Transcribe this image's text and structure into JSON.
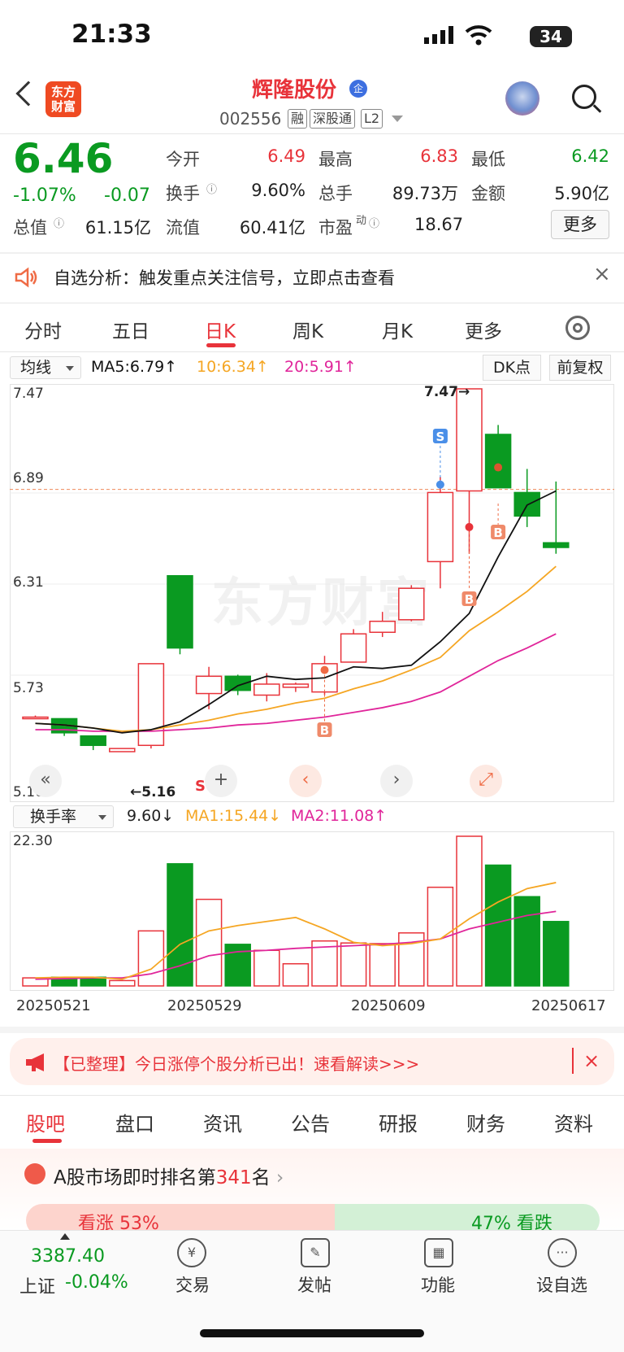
{
  "status_bar": {
    "time": "21:33",
    "battery": "34"
  },
  "header": {
    "logo_text": "东方财富",
    "stock_name": "辉隆股份",
    "badge": "企",
    "code": "002556",
    "tags": [
      "融",
      "深股通",
      "L2"
    ]
  },
  "quote": {
    "price": "6.46",
    "change_pct": "-1.07%",
    "change": "-0.07",
    "open_label": "今开",
    "open": "6.49",
    "high_label": "最高",
    "high": "6.83",
    "low_label": "最低",
    "low": "6.42",
    "turnover_label": "换手",
    "turnover": "9.60%",
    "volume_label": "总手",
    "volume": "89.73万",
    "amount_label": "金额",
    "amount": "5.90亿",
    "mktcap_label": "总值",
    "mktcap": "61.15亿",
    "float_label": "流值",
    "float": "60.41亿",
    "pe_label": "市盈",
    "pe_sup": "动",
    "pe": "18.67",
    "more_label": "更多"
  },
  "alert": {
    "text": "自选分析：触发重点关注信号，立即点击查看",
    "close": "×"
  },
  "tabs": [
    "分时",
    "五日",
    "日K",
    "周K",
    "月K",
    "更多"
  ],
  "ma_row": {
    "select": "均线",
    "ma5": "MA5:6.79↑",
    "ma10": "10:6.34↑",
    "ma20": "20:5.91↑",
    "dk": "DK点",
    "fq": "前复权"
  },
  "kline": {
    "y_labels": [
      "7.47",
      "6.89",
      "6.31",
      "5.73",
      "5.16"
    ],
    "high_marker": "7.47→",
    "low_marker": "←5.16",
    "watermark": "东方财富",
    "signals": {
      "s_blue": "S",
      "s_red": "S",
      "b1": "B",
      "b2": "B",
      "b3": "B"
    }
  },
  "turnover_row": {
    "select": "换手率",
    "value": "9.60↓",
    "ma1": "MA1:15.44↓",
    "ma2": "MA2:11.08↑",
    "y_max": "22.30"
  },
  "dates": [
    "20250521",
    "20250529",
    "20250609",
    "20250617"
  ],
  "ad": {
    "text": "【已整理】今日涨停个股分析已出！速看解读>>>",
    "close": "×"
  },
  "bottom_tabs": [
    "股吧",
    "盘口",
    "资讯",
    "公告",
    "研报",
    "财务",
    "资料"
  ],
  "rank": {
    "prefix": "A股市场即时排名第",
    "num": "341",
    "suffix": "名",
    "bull": "看涨 53%",
    "bear": "47% 看跌"
  },
  "bottom_nav": {
    "index_value": "3387.40",
    "index_label": "上证",
    "index_pct": "-0.04%",
    "items": [
      "交易",
      "发帖",
      "功能",
      "设自选"
    ]
  },
  "colors": {
    "up": "#e8333a",
    "down": "#0a9a21",
    "ma5": "#111111",
    "ma10": "#f5a623",
    "ma20": "#e0259a"
  },
  "chart_data": {
    "type": "candlestick",
    "title": "",
    "ylim": [
      5.16,
      7.47
    ],
    "candles": [
      {
        "o": 5.38,
        "h": 5.39,
        "l": 5.37,
        "c": 5.38
      },
      {
        "o": 5.37,
        "h": 5.37,
        "l": 5.26,
        "c": 5.28
      },
      {
        "o": 5.26,
        "h": 5.26,
        "l": 5.17,
        "c": 5.2
      },
      {
        "o": 5.16,
        "h": 5.18,
        "l": 5.16,
        "c": 5.18
      },
      {
        "o": 5.2,
        "h": 5.72,
        "l": 5.18,
        "c": 5.72
      },
      {
        "o": 6.28,
        "h": 6.28,
        "l": 5.78,
        "c": 5.82
      },
      {
        "o": 5.53,
        "h": 5.7,
        "l": 5.43,
        "c": 5.64
      },
      {
        "o": 5.64,
        "h": 5.65,
        "l": 5.52,
        "c": 5.55
      },
      {
        "o": 5.52,
        "h": 5.66,
        "l": 5.48,
        "c": 5.59
      },
      {
        "o": 5.57,
        "h": 5.6,
        "l": 5.54,
        "c": 5.59
      },
      {
        "o": 5.54,
        "h": 5.77,
        "l": 5.52,
        "c": 5.72
      },
      {
        "o": 5.73,
        "h": 5.94,
        "l": 5.73,
        "c": 5.91
      },
      {
        "o": 5.92,
        "h": 6.05,
        "l": 5.89,
        "c": 5.99
      },
      {
        "o": 6.0,
        "h": 6.22,
        "l": 5.99,
        "c": 6.2
      },
      {
        "o": 6.37,
        "h": 6.91,
        "l": 6.2,
        "c": 6.81
      },
      {
        "o": 6.82,
        "h": 7.47,
        "l": 6.42,
        "c": 7.47
      },
      {
        "o": 7.18,
        "h": 7.24,
        "l": 6.84,
        "c": 6.84
      },
      {
        "o": 6.81,
        "h": 6.96,
        "l": 6.59,
        "c": 6.66
      },
      {
        "o": 6.49,
        "h": 6.88,
        "l": 6.42,
        "c": 6.46
      }
    ],
    "ma5": [
      5.34,
      5.33,
      5.31,
      5.28,
      5.3,
      5.35,
      5.46,
      5.58,
      5.64,
      5.62,
      5.63,
      5.7,
      5.69,
      5.71,
      5.86,
      6.04,
      6.4,
      6.73,
      6.82
    ],
    "ma10": [
      5.34,
      5.33,
      5.31,
      5.29,
      5.3,
      5.33,
      5.36,
      5.4,
      5.43,
      5.47,
      5.5,
      5.56,
      5.61,
      5.68,
      5.76,
      5.93,
      6.05,
      6.18,
      6.34
    ],
    "ma20": [
      5.3,
      5.3,
      5.29,
      5.29,
      5.29,
      5.3,
      5.31,
      5.33,
      5.34,
      5.36,
      5.38,
      5.41,
      5.44,
      5.48,
      5.54,
      5.64,
      5.74,
      5.82,
      5.91
    ],
    "turnover": [
      1.2,
      1.3,
      1.3,
      0.8,
      8.2,
      18.2,
      12.9,
      6.2,
      5.3,
      3.3,
      6.7,
      6.4,
      6.3,
      7.9,
      14.7,
      22.3,
      18.0,
      13.3,
      9.6
    ],
    "turnover_ma1": [
      1.2,
      1.3,
      1.3,
      1.0,
      2.5,
      6.2,
      8.2,
      9.0,
      9.6,
      10.2,
      8.5,
      6.5,
      6.0,
      6.3,
      7.0,
      10.0,
      12.5,
      14.5,
      15.4
    ],
    "turnover_ma2": [
      1.0,
      1.1,
      1.2,
      1.2,
      1.8,
      3.0,
      4.5,
      5.1,
      5.3,
      5.6,
      5.8,
      6.0,
      6.2,
      6.5,
      7.0,
      8.5,
      9.5,
      10.5,
      11.1
    ],
    "turnover_ylim": [
      0,
      22.3
    ]
  }
}
